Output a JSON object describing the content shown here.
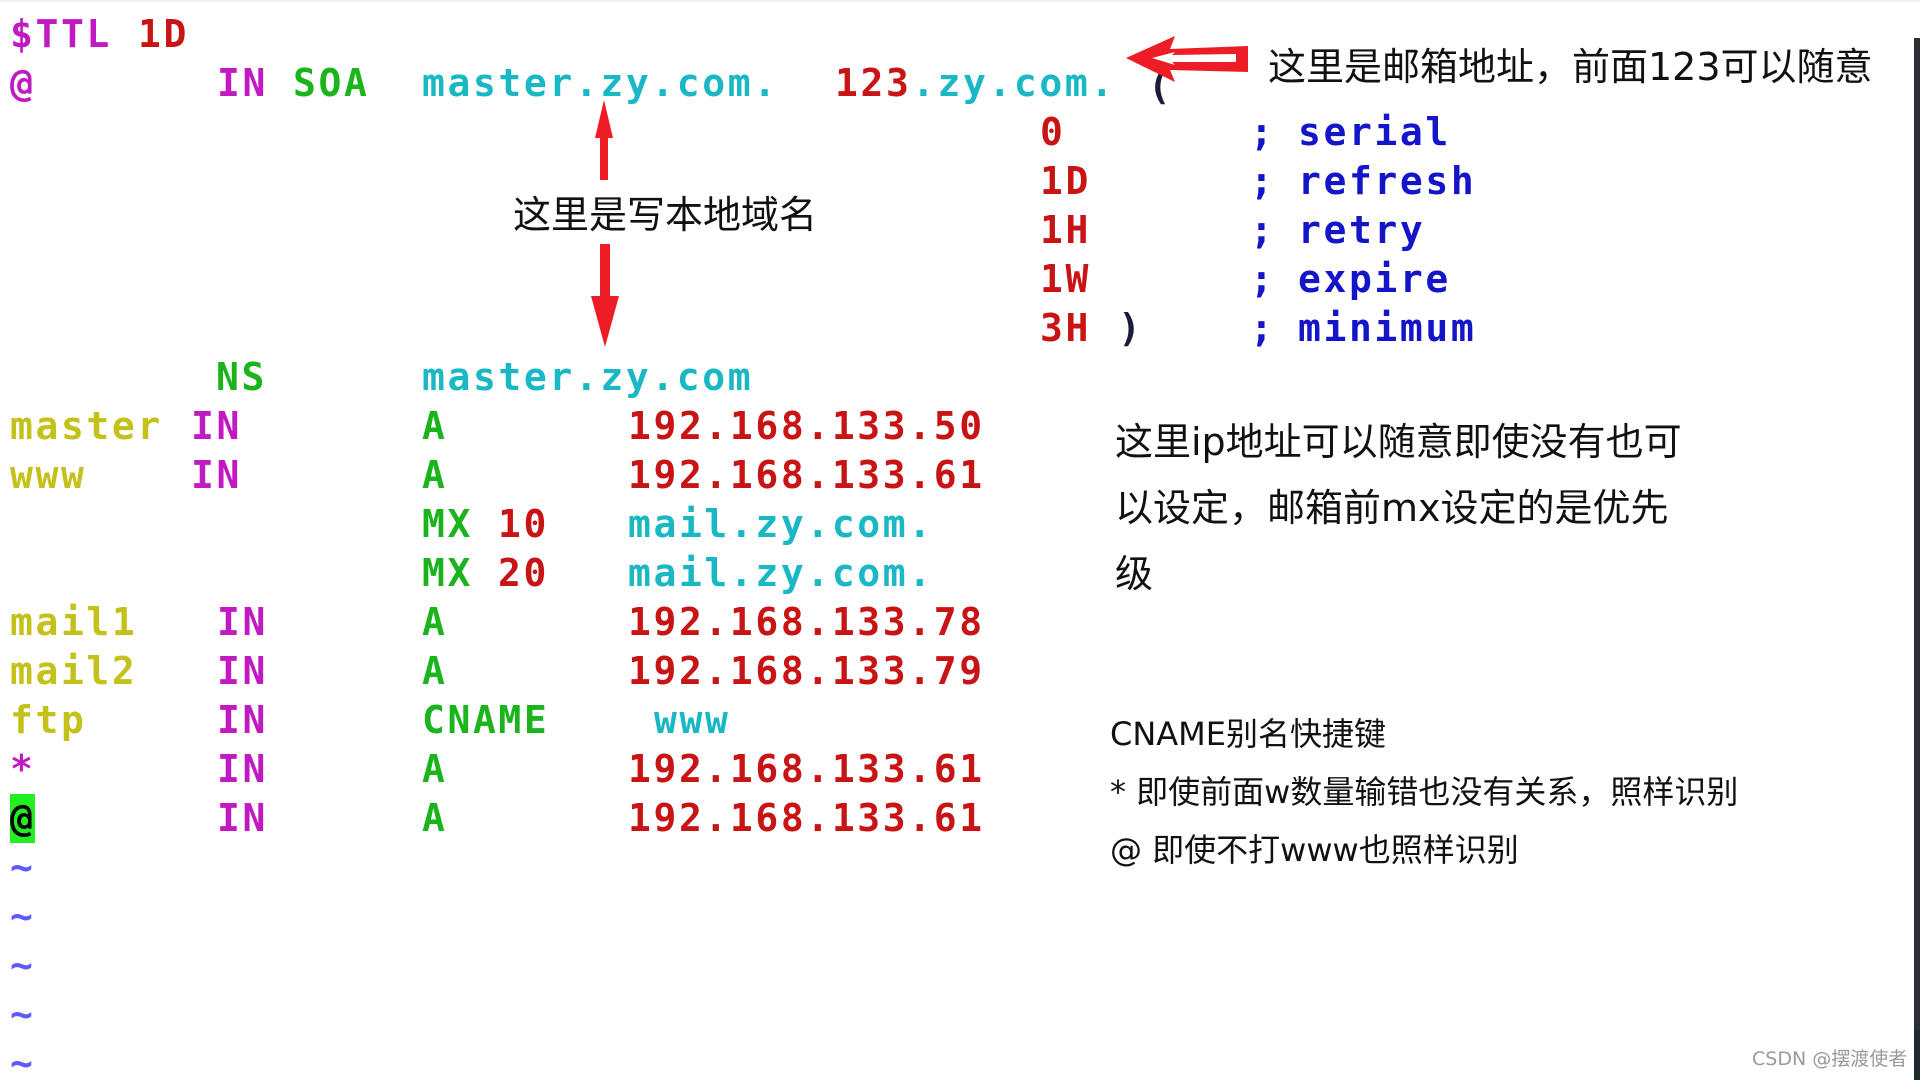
{
  "zone_file": {
    "lines": [
      {
        "cols": [
          {
            "text": "$TTL",
            "color": "magenta"
          },
          {
            "text": "1D",
            "color": "red"
          }
        ]
      },
      {
        "cols": [
          {
            "text": "@",
            "color": "magenta"
          },
          {
            "text": "IN",
            "color": "magenta"
          },
          {
            "text": "SOA",
            "color": "green"
          },
          {
            "text": "master.zy.com.",
            "color": "cyan"
          },
          {
            "text": "123",
            "color": "red"
          },
          {
            "text": ".zy.com.",
            "color": "cyan"
          },
          {
            "text": "(",
            "color": "dark"
          }
        ]
      },
      {
        "cols": [
          {
            "text": "0",
            "color": "red"
          },
          {
            "text": ";",
            "color": "blue"
          },
          {
            "text": "serial",
            "color": "blue"
          }
        ]
      },
      {
        "cols": [
          {
            "text": "1D",
            "color": "red"
          },
          {
            "text": ";",
            "color": "blue"
          },
          {
            "text": "refresh",
            "color": "blue"
          }
        ]
      },
      {
        "cols": [
          {
            "text": "1H",
            "color": "red"
          },
          {
            "text": ";",
            "color": "blue"
          },
          {
            "text": "retry",
            "color": "blue"
          }
        ]
      },
      {
        "cols": [
          {
            "text": "1W",
            "color": "red"
          },
          {
            "text": ";",
            "color": "blue"
          },
          {
            "text": "expire",
            "color": "blue"
          }
        ]
      },
      {
        "cols": [
          {
            "text": "3H",
            "color": "red"
          },
          {
            "text": ")",
            "color": "dark"
          },
          {
            "text": ";",
            "color": "blue"
          },
          {
            "text": "minimum",
            "color": "blue"
          }
        ]
      },
      {
        "cols": [
          {
            "text": "NS",
            "color": "green"
          },
          {
            "text": "master.zy.com",
            "color": "cyan"
          }
        ]
      },
      {
        "cols": [
          {
            "text": "master",
            "color": "olive"
          },
          {
            "text": "IN",
            "color": "magenta"
          },
          {
            "text": "A",
            "color": "green"
          },
          {
            "text": "192.168.133.50",
            "color": "red"
          }
        ]
      },
      {
        "cols": [
          {
            "text": "www",
            "color": "olive"
          },
          {
            "text": "IN",
            "color": "magenta"
          },
          {
            "text": "A",
            "color": "green"
          },
          {
            "text": "192.168.133.61",
            "color": "red"
          }
        ]
      },
      {
        "cols": [
          {
            "text": "MX",
            "color": "green"
          },
          {
            "text": "10",
            "color": "red"
          },
          {
            "text": "mail.zy.com.",
            "color": "cyan"
          }
        ]
      },
      {
        "cols": [
          {
            "text": "MX",
            "color": "green"
          },
          {
            "text": "20",
            "color": "red"
          },
          {
            "text": "mail.zy.com.",
            "color": "cyan"
          }
        ]
      },
      {
        "cols": [
          {
            "text": "mail1",
            "color": "olive"
          },
          {
            "text": "IN",
            "color": "magenta"
          },
          {
            "text": "A",
            "color": "green"
          },
          {
            "text": "192.168.133.78",
            "color": "red"
          }
        ]
      },
      {
        "cols": [
          {
            "text": "mail2",
            "color": "olive"
          },
          {
            "text": "IN",
            "color": "magenta"
          },
          {
            "text": "A",
            "color": "green"
          },
          {
            "text": "192.168.133.79",
            "color": "red"
          }
        ]
      },
      {
        "cols": [
          {
            "text": "ftp",
            "color": "olive"
          },
          {
            "text": "IN",
            "color": "magenta"
          },
          {
            "text": "CNAME",
            "color": "green"
          },
          {
            "text": "www",
            "color": "cyan"
          }
        ]
      },
      {
        "cols": [
          {
            "text": "*",
            "color": "magenta"
          },
          {
            "text": "IN",
            "color": "magenta"
          },
          {
            "text": "A",
            "color": "green"
          },
          {
            "text": "192.168.133.61",
            "color": "red"
          }
        ]
      },
      {
        "cols": [
          {
            "text": "@",
            "color": "cursor"
          },
          {
            "text": "IN",
            "color": "magenta"
          },
          {
            "text": "A",
            "color": "green"
          },
          {
            "text": "192.168.133.61",
            "color": "red"
          }
        ]
      }
    ],
    "empty_line_marker": "~",
    "empty_line_count": 5
  },
  "annotations": {
    "email_note": "这里是邮箱地址，前面123可以随意",
    "domain_note": "这里是写本地域名",
    "ip_note": [
      "这里ip地址可以随意即使没有也可",
      "以设定，邮箱前mx设定的是优先",
      "级"
    ],
    "cname_note": "CNAME别名快捷键",
    "wildcard_note": "* 即使前面w数量输错也没有关系，照样识别",
    "at_note": "@ 即使不打www也照样识别"
  },
  "watermark": "CSDN @摆渡使者",
  "colors": {
    "magenta": "#c21ac2",
    "red": "#c81414",
    "green": "#1cb41c",
    "cyan": "#1ab8c4",
    "olive": "#c4c21a",
    "blue": "#1414c8",
    "tilde": "#5a5aff",
    "arrow": "#ee1c24",
    "cursor": "#22ee22"
  }
}
